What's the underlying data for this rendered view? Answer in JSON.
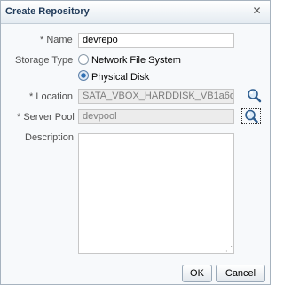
{
  "dialog": {
    "title": "Create Repository",
    "close_label": "✕"
  },
  "form": {
    "name": {
      "required_mark": "*",
      "label": "Name",
      "value": "devrepo"
    },
    "storage_type": {
      "label": "Storage Type",
      "options": [
        {
          "label": "Network File System",
          "checked": false
        },
        {
          "label": "Physical Disk",
          "checked": true
        }
      ]
    },
    "location": {
      "required_mark": "*",
      "label": "Location",
      "value": "SATA_VBOX_HARDDISK_VB1a6d"
    },
    "server_pool": {
      "required_mark": "*",
      "label": "Server Pool",
      "value": "devpool"
    },
    "description": {
      "label": "Description",
      "value": ""
    }
  },
  "buttons": {
    "ok": "OK",
    "cancel": "Cancel"
  },
  "icons": {
    "location_search": "magnifier-icon",
    "server_pool_search": "magnifier-icon"
  }
}
